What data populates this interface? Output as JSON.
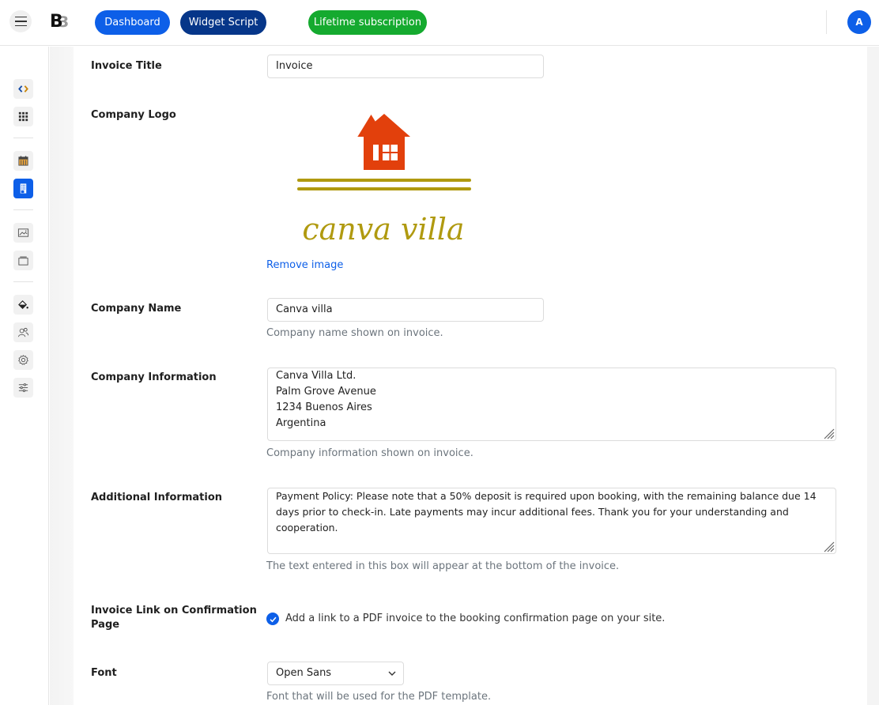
{
  "topbar": {
    "menu_icon": "hamburger-icon",
    "logo_text_primary": "B",
    "logo_text_secondary": "3",
    "buttons": {
      "dashboard": "Dashboard",
      "widget_script": "Widget Script",
      "lifetime": "Lifetime subscription"
    },
    "avatar_initial": "A"
  },
  "sidebar": {
    "items": [
      {
        "icon": "code-icon",
        "active": false
      },
      {
        "icon": "grid-icon",
        "active": false
      },
      {
        "icon": "calendar-icon",
        "active": false
      },
      {
        "icon": "building-icon",
        "active": true
      },
      {
        "icon": "image-icon",
        "active": false
      },
      {
        "icon": "window-icon",
        "active": false
      },
      {
        "icon": "paint-bucket-icon",
        "active": false
      },
      {
        "icon": "users-icon",
        "active": false
      },
      {
        "icon": "gear-icon",
        "active": false
      },
      {
        "icon": "sliders-icon",
        "active": false
      }
    ]
  },
  "form": {
    "invoice_title": {
      "label": "Invoice Title",
      "value": "Invoice"
    },
    "company_logo": {
      "label": "Company Logo",
      "logo_text": "canva villa",
      "remove_link": "Remove image"
    },
    "company_name": {
      "label": "Company Name",
      "value": "Canva villa",
      "help": "Company name shown on invoice."
    },
    "company_information": {
      "label": "Company Information",
      "lines": [
        "Canva Villa Ltd.",
        "Palm Grove Avenue",
        "1234 Buenos Aires",
        "Argentina"
      ],
      "help": "Company information shown on invoice."
    },
    "additional_information": {
      "label": "Additional Information",
      "lines": [
        "Payment Policy: Please note that a 50% deposit is required upon booking, with the remaining balance due 14",
        "days prior to check-in. Late payments may incur additional fees. Thank you for your understanding and",
        "cooperation."
      ],
      "help": "The text entered in this box will appear at the bottom of the invoice."
    },
    "invoice_link": {
      "label_line1": "Invoice Link on Confirmation",
      "label_line2": "Page",
      "checked": true,
      "checkbox_label": "Add a link to a PDF invoice to the booking confirmation page on your site."
    },
    "font": {
      "label": "Font",
      "selected": "Open Sans",
      "help": "Font that will be used for the PDF template."
    }
  },
  "colors": {
    "primary": "#0d5fe8",
    "navy": "#063689",
    "green": "#15aa2f",
    "logo_house": "#e2400c",
    "logo_olive": "#b09a10"
  }
}
